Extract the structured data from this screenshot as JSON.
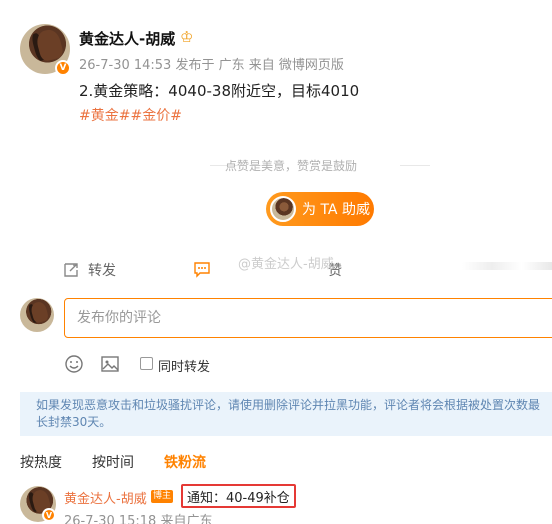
{
  "post": {
    "author": "黄金达人-胡威",
    "meta": "26-7-30 14:53 发布于 广东 来自 微博网页版",
    "text": "2.黄金策略：4040-38附近空，目标4010",
    "tags": "#黄金##金价#"
  },
  "reward": {
    "divider_text": "点赞是美意，赞赏是鼓励",
    "button_label": "为 TA 助威"
  },
  "actions": {
    "repost": "转发",
    "like": "赞",
    "watermark": "@黄金达人-胡威"
  },
  "compose": {
    "placeholder": "发布你的评论",
    "also_repost": "同时转发"
  },
  "notice": "如果发现恶意攻击和垃圾骚扰评论，请使用删除评论并拉黑功能，评论者将会根据被处置次数最长封禁30天。",
  "sort_tabs": [
    "按热度",
    "按时间",
    "铁粉流"
  ],
  "comment": {
    "author": "黄金达人-胡威",
    "badge": "博主",
    "text": "通知：40-49补仓",
    "meta": "26-7-30 15:18 来自广东"
  },
  "colors": {
    "accent": "#ff8200",
    "tag": "#eb7340",
    "notice_bg": "#eaf3fb",
    "notice_text": "#5f86b2",
    "highlight_border": "#e53935"
  }
}
